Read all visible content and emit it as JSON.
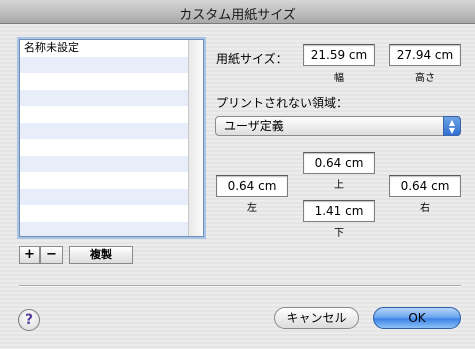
{
  "window": {
    "title": "カスタム用紙サイズ"
  },
  "list": {
    "items": [
      "名称未設定",
      "",
      "",
      "",
      "",
      "",
      "",
      "",
      "",
      "",
      "",
      ""
    ]
  },
  "list_buttons": {
    "add": "+",
    "remove": "−",
    "duplicate": "複製"
  },
  "paper_size": {
    "label": "用紙サイズ：",
    "width_value": "21.59 cm",
    "width_label": "幅",
    "height_value": "27.94 cm",
    "height_label": "高さ"
  },
  "nonprintable": {
    "label": "プリントされない領域：",
    "selected": "ユーザ定義",
    "top_value": "0.64 cm",
    "top_label": "上",
    "left_value": "0.64 cm",
    "left_label": "左",
    "right_value": "0.64 cm",
    "right_label": "右",
    "bottom_value": "1.41 cm",
    "bottom_label": "下"
  },
  "footer": {
    "help": "?",
    "cancel": "キャンセル",
    "ok": "OK"
  }
}
